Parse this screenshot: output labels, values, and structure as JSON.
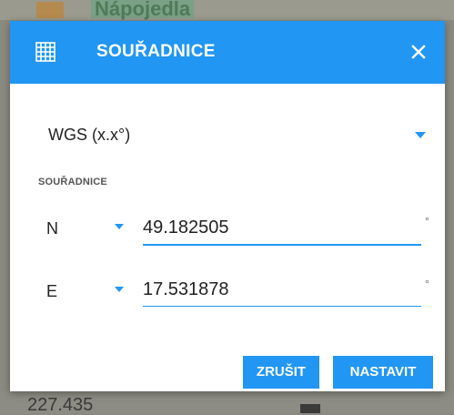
{
  "background": {
    "top_text": "Nápojedla",
    "bottom_text": "227.435"
  },
  "dialog": {
    "title": "SOUŘADNICE",
    "title_icon": "grid-icon",
    "close_icon": "close-icon",
    "format": {
      "value": "WGS (x.x°)"
    },
    "section_label": "SOUŘADNICE",
    "rows": [
      {
        "label": "N",
        "value": "49.182505",
        "unit": "°"
      },
      {
        "label": "E",
        "value": "17.531878",
        "unit": "°"
      }
    ],
    "buttons": {
      "cancel": "ZRUŠIT",
      "confirm": "NASTAVIT"
    }
  },
  "colors": {
    "accent": "#2196f3",
    "title_text": "#ffffff",
    "body_text": "#222222"
  }
}
